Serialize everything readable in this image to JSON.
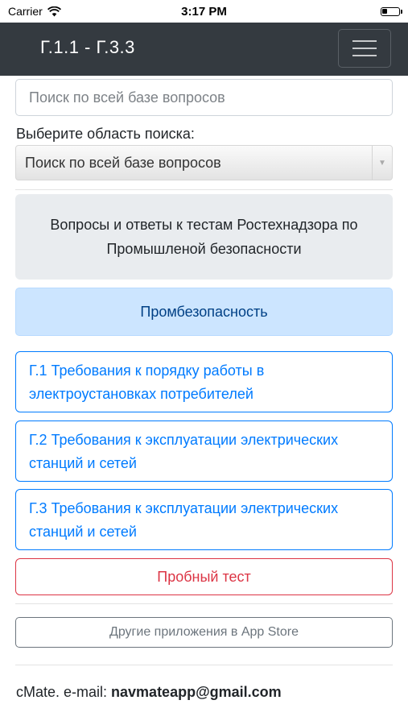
{
  "status_bar": {
    "carrier": "Carrier",
    "time": "3:17 PM",
    "wifi_icon": "wifi-icon",
    "battery_icon": "battery-icon"
  },
  "navbar": {
    "title": "Г.1.1 - Г.3.3",
    "menu_icon": "hamburger-menu-icon",
    "background_color": "#343a40"
  },
  "search": {
    "placeholder": "Поиск по всей базе вопросов",
    "value": ""
  },
  "area": {
    "label": "Выберите область поиска:",
    "selected": "Поиск по всей базе вопросов"
  },
  "intro": {
    "text": "Вопросы и ответы к тестам Ростехнадзора по Промышленой безопасности"
  },
  "category": {
    "label": "Промбезопасность",
    "color": "#004085",
    "background": "#cce5ff"
  },
  "topics": [
    {
      "label": "Г.1 Требования к порядку работы в электроустановках потребителей"
    },
    {
      "label": "Г.2 Требования к эксплуатации электрических станций и сетей"
    },
    {
      "label": "Г.3 Требования к эксплуатации электрических станций и сетей"
    }
  ],
  "trial_test": {
    "label": "Пробный тест",
    "color": "#dc3545"
  },
  "other_apps": {
    "label": "Другие приложения в App Store"
  },
  "footer": {
    "prefix": "cMate. e-mail: ",
    "email": "navmateapp@gmail.com"
  },
  "colors": {
    "primary": "#007bff",
    "secondary": "#6c757d"
  }
}
